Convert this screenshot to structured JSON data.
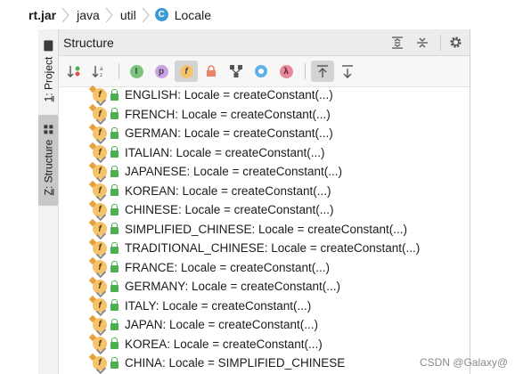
{
  "breadcrumb": {
    "items": [
      "rt.jar",
      "java",
      "util",
      "Locale"
    ],
    "class_icon_letter": "C"
  },
  "side_tabs": {
    "project": {
      "number": "1",
      "label": ": Project"
    },
    "structure": {
      "number": "Z",
      "label": ": Structure"
    }
  },
  "panel": {
    "title": "Structure"
  },
  "toolbar": {
    "icons": [
      "sort-visibility",
      "sort-alphabetically",
      "show-inherited",
      "show-properties",
      "show-fields",
      "show-non-public",
      "show-lambdas",
      "show-anonymous",
      "show-lambda",
      "autoscroll-to-source",
      "autoscroll-from-source"
    ],
    "letters": {
      "inherited": "I",
      "properties": "p",
      "fields": "f",
      "lambda": "λ"
    }
  },
  "fields": [
    "ENGLISH: Locale = createConstant(...)",
    "FRENCH: Locale = createConstant(...)",
    "GERMAN: Locale = createConstant(...)",
    "ITALIAN: Locale = createConstant(...)",
    "JAPANESE: Locale = createConstant(...)",
    "KOREAN: Locale = createConstant(...)",
    "CHINESE: Locale = createConstant(...)",
    "SIMPLIFIED_CHINESE: Locale = createConstant(...)",
    "TRADITIONAL_CHINESE: Locale = createConstant(...)",
    "FRANCE: Locale = createConstant(...)",
    "GERMANY: Locale = createConstant(...)",
    "ITALY: Locale = createConstant(...)",
    "JAPAN: Locale = createConstant(...)",
    "KOREA: Locale = createConstant(...)",
    "CHINA: Locale = SIMPLIFIED_CHINESE"
  ],
  "field_icon_letter": "f",
  "watermark": "CSDN @Galaxy@",
  "colors": {
    "field_icon": "#f5c36b",
    "lock": "#4caf50",
    "class_icon": "#3d9bd6"
  }
}
